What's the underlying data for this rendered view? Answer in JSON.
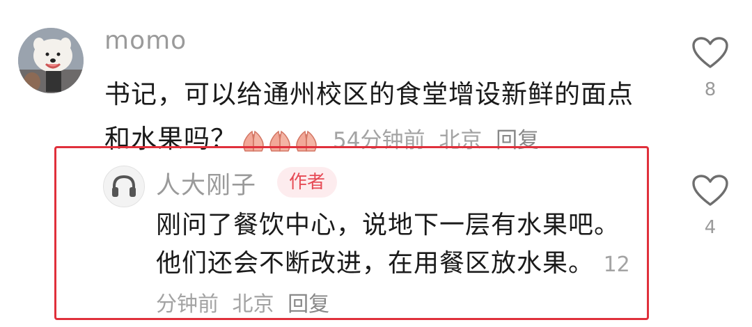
{
  "comment": {
    "username": "momo",
    "text": "书记，可以给通州校区的食堂增设新鲜的面点和水果吗？",
    "emojis": [
      "pray-emoji",
      "pray-emoji",
      "pray-emoji"
    ],
    "time": "54分钟前",
    "location": "北京",
    "reply_label": "回复",
    "like_count": "8"
  },
  "reply": {
    "username": "人大刚子",
    "badge": "作者",
    "text": "刚问了餐饮中心，说地下一层有水果吧。他们还会不断改进，在用餐区放水果。",
    "time": "12分钟前",
    "location": "北京",
    "reply_label": "回复",
    "like_count": "4",
    "highlight_color": "#e0303b"
  },
  "colors": {
    "text": "#1a1a1a",
    "meta": "#a3a3a3",
    "badge_bg": "#fdecee",
    "badge_text": "#e64a55"
  },
  "icons": {
    "like": "heart-outline-icon",
    "reply_avatar": "headphones-icon"
  }
}
